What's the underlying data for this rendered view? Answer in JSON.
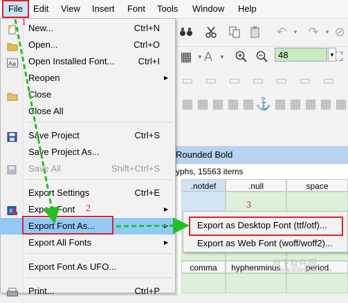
{
  "menubar": {
    "items": [
      "File",
      "Edit",
      "View",
      "Insert",
      "Font",
      "Tools",
      "Window",
      "Help"
    ]
  },
  "toolbar": {
    "zoom_value": "48"
  },
  "font_window": {
    "title": "Rounded Bold",
    "info": "yphs, 15563 items",
    "glyph_row1": [
      ".notdef",
      ".null",
      "space"
    ],
    "glyph_row2": [
      "comma",
      "hyphenminus",
      "period"
    ]
  },
  "file_menu": {
    "items": [
      {
        "label": "New...",
        "shortcut": "Ctrl+N",
        "icon": "new-file-icon"
      },
      {
        "label": "Open...",
        "shortcut": "Ctrl+O",
        "icon": "open-folder-icon"
      },
      {
        "label": "Open Installed Font...",
        "shortcut": "Ctrl+I",
        "icon": "installed-font-icon"
      },
      {
        "label": "Reopen",
        "shortcut": "",
        "submenu": true
      },
      {
        "label": "Close",
        "shortcut": "",
        "icon": "close-folder-icon"
      },
      {
        "label": "Close All",
        "shortcut": ""
      },
      {
        "label": "Save Project",
        "shortcut": "Ctrl+S",
        "icon": "save-icon"
      },
      {
        "label": "Save Project As...",
        "shortcut": ""
      },
      {
        "label": "Save All",
        "shortcut": "Shift+Ctrl+S",
        "disabled": true,
        "icon": "save-all-icon"
      },
      {
        "label": "Export Settings",
        "shortcut": "Ctrl+E"
      },
      {
        "label": "Export Font",
        "shortcut": "",
        "submenu": true,
        "icon": "export-font-icon"
      },
      {
        "label": "Export Font As...",
        "shortcut": "",
        "submenu": true,
        "highlighted": true
      },
      {
        "label": "Export All Fonts",
        "shortcut": "",
        "submenu": true
      },
      {
        "label": "Export Font As UFO...",
        "shortcut": ""
      },
      {
        "label": "Print...",
        "shortcut": "Ctrl+P",
        "icon": "print-icon"
      }
    ]
  },
  "export_submenu": {
    "items": [
      "Export as Desktop Font (ttf/otf)...",
      "Export as Web Font (woff/woff2)..."
    ]
  },
  "annotations": {
    "step1": "1",
    "step2": "2",
    "step3": "3",
    "color": "#e0202a",
    "arrow_color": "#22c022"
  },
  "watermark": {
    "line1": "当下软件园",
    "line2": "www.downxia.com"
  }
}
